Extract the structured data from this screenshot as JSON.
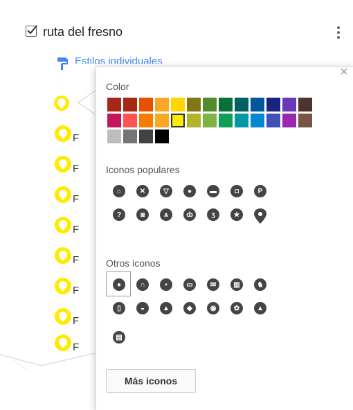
{
  "layer": {
    "name": "ruta del fresno",
    "checked": true
  },
  "style_link": {
    "label": "Estilos individuales"
  },
  "list": {
    "items": [
      {
        "label": ""
      },
      {
        "label": "F"
      },
      {
        "label": "F"
      },
      {
        "label": "F"
      },
      {
        "label": "F"
      },
      {
        "label": "F"
      },
      {
        "label": "F"
      },
      {
        "label": "F"
      },
      {
        "label": "F"
      }
    ]
  },
  "popup": {
    "color_label": "Color",
    "popular_label": "Iconos populares",
    "other_label": "Otros iconos",
    "more_icons_label": "Más iconos",
    "close_label": "×"
  },
  "colors": {
    "row1": [
      "#a52714",
      "#c2185b",
      "#e65100",
      "#f9a825",
      "#ffd600",
      "#817717",
      "#558b2f",
      "#097138",
      "#006064",
      "#01579b",
      "#1a237e",
      "#673ab7",
      "#4e342e"
    ],
    "row1_actual": [
      "#a52714",
      "#a52714",
      "#e65100",
      "#f9a825",
      "#ffd600",
      "#817717",
      "#558b2f",
      "#097138",
      "#006064",
      "#01579b",
      "#1a237e",
      "#673ab7",
      "#4e342e"
    ],
    "row2": [
      "#c2185b",
      "#ff5252",
      "#f57c00",
      "#f9a825",
      "#ffea00",
      "#afb42b",
      "#7cb342",
      "#0f9d58",
      "#0097a7",
      "#0288d1",
      "#3f51b5",
      "#9c27b0",
      "#795548"
    ],
    "row3": [
      "#bdbdbd",
      "#757575",
      "#424242",
      "#000000"
    ],
    "selected": "#ffea00"
  },
  "icons": {
    "popular": [
      "home-icon",
      "fork-knife-icon",
      "cocktail-icon",
      "pin-icon",
      "bed-icon",
      "shopping-bag-icon",
      "parking-icon",
      "help-icon",
      "camera-icon",
      "walker-icon",
      "bike-icon",
      "runner-icon",
      "star-icon",
      "location-marker-icon"
    ],
    "other_row1": [
      "pin-icon",
      "arch-icon",
      "cup-icon",
      "monitor-icon",
      "envelope-icon",
      "building-icon",
      "dog-icon"
    ],
    "other_row2": [
      "book-icon",
      "bird-icon",
      "monument-icon",
      "graduation-cap-icon",
      "eye-icon",
      "flower-icon",
      "tomb-icon"
    ],
    "other_row3": [
      "id-card-icon"
    ]
  }
}
